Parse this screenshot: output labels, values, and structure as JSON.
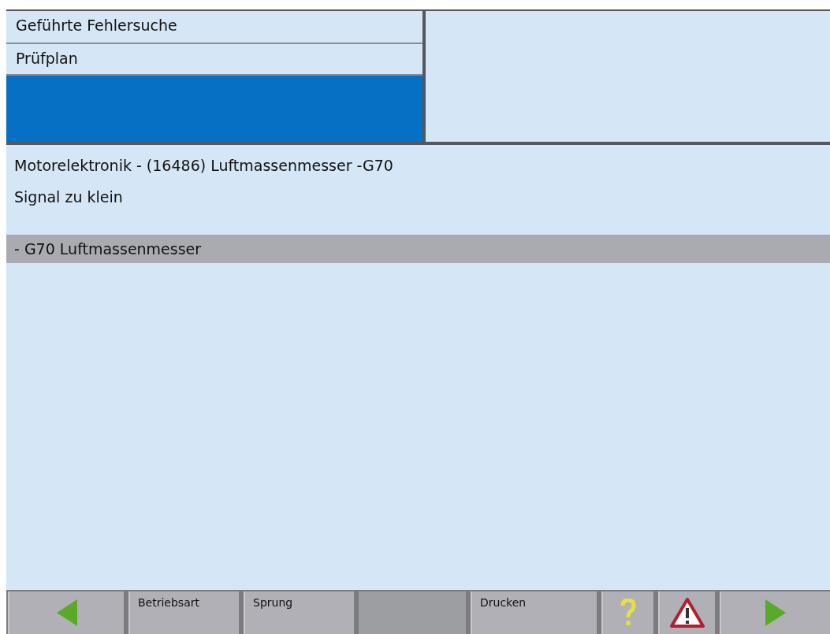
{
  "header": {
    "items": [
      {
        "label": "Geführte Fehlersuche"
      },
      {
        "label": "Prüfplan"
      }
    ]
  },
  "message": {
    "lines": [
      "Motorelektronik - (16486) Luftmassenmesser -G70",
      "Signal zu klein"
    ]
  },
  "tests": [
    {
      "label": "- G70 Luftmassenmesser",
      "selected": true
    }
  ],
  "toolbar": [
    {
      "kind": "back"
    },
    {
      "kind": "text",
      "label": "Betriebsart"
    },
    {
      "kind": "text",
      "label": "Sprung"
    },
    {
      "kind": "blank"
    },
    {
      "kind": "text",
      "label": "Drucken"
    },
    {
      "kind": "help"
    },
    {
      "kind": "warning"
    },
    {
      "kind": "forward"
    }
  ]
}
